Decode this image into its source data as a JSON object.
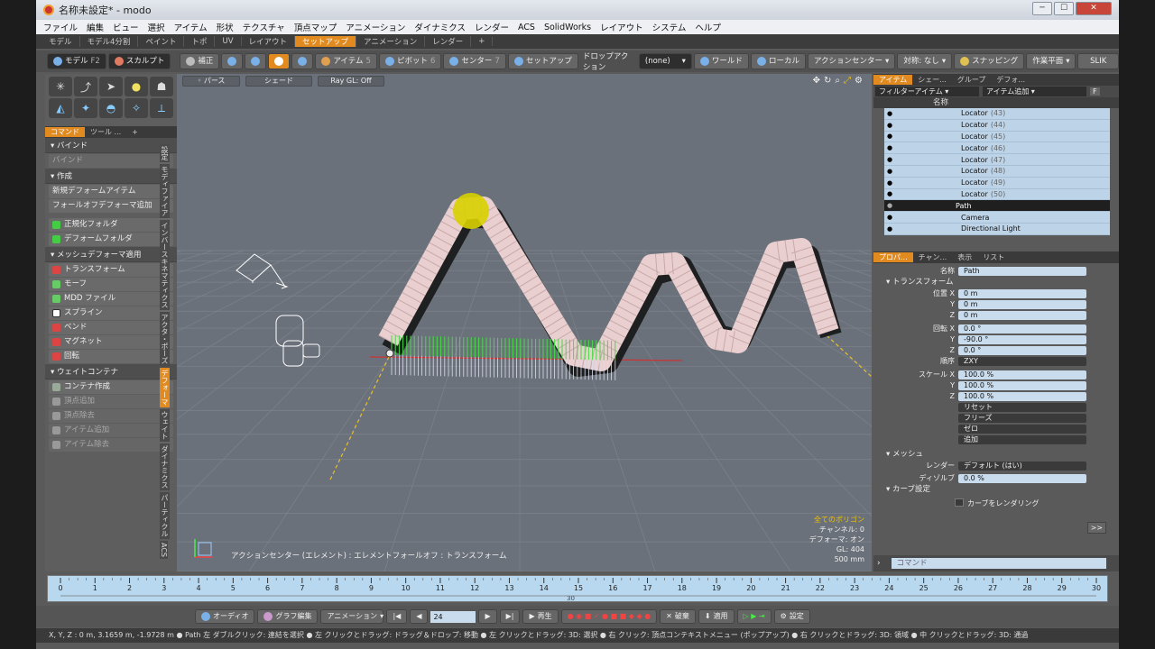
{
  "window": {
    "title": "名称未設定* - modo"
  },
  "menu": [
    "ファイル",
    "編集",
    "ビュー",
    "選択",
    "アイテム",
    "形状",
    "テクスチャ",
    "頂点マップ",
    "アニメーション",
    "ダイナミクス",
    "レンダー",
    "ACS",
    "SolidWorks",
    "レイアウト",
    "システム",
    "ヘルプ"
  ],
  "layout_tabs": [
    "モデル",
    "モデル4分割",
    "ペイント",
    "トポ",
    "UV",
    "レイアウト",
    "セットアップ",
    "アニメーション",
    "レンダー",
    "+"
  ],
  "layout_active": "セットアップ",
  "toolbar": {
    "model": "モデル",
    "model_key": "F2",
    "sculpt": "スカルプト",
    "correct": "補正",
    "item": "アイテム",
    "item_n": "5",
    "pivot": "ピボット",
    "pivot_n": "6",
    "center": "センター",
    "center_n": "7",
    "setup": "セットアップ",
    "drop_action": "ドロップアクション",
    "none": "(none)",
    "world": "ワールド",
    "local": "ローカル",
    "action_center": "アクションセンター",
    "symmetry": "対称: なし",
    "snapping": "スナッピング",
    "workplane": "作業平面",
    "slik": "SLIK"
  },
  "left": {
    "tabs": [
      "コマンド",
      "ツール ...",
      "+"
    ],
    "bind_section": "バインド",
    "bind_btn": "バインド",
    "create_section": "作成",
    "new_deformer": "新規デフォームアイテム",
    "add_falloff": "フォールオフデフォーマ追加",
    "folder_norm": "正規化フォルダ",
    "folder_deform": "デフォームフォルダ",
    "mesh_section": "メッシュデフォーマ適用",
    "items": [
      "トランスフォーム",
      "モーフ",
      "MDD ファイル",
      "スプライン",
      "ベンド",
      "マグネット",
      "回転"
    ],
    "weight_section": "ウェイトコンテナ",
    "weight_items": [
      "コンテナ作成",
      "頂点追加",
      "頂点除去",
      "アイテム追加",
      "アイテム除去"
    ],
    "vtabs": [
      "設定",
      "モディファイア",
      "インバースキネマティクス",
      "アクタ・ポーズ",
      "デフォーマ",
      "ウェイト",
      "ダイナミクス",
      "パーティクル",
      "ACS"
    ]
  },
  "viewport": {
    "btn_perspective": "パース",
    "btn_shade": "シェード",
    "btn_raygl": "Ray GL: Off",
    "status": "アクションセンター (エレメント) : エレメントフォールオフ : トランスフォーム",
    "info": [
      "全てのポリゴン",
      "チャンネル: 0",
      "デフォーマ: オン",
      "GL: 404",
      "500 mm"
    ]
  },
  "items_panel": {
    "tabs": [
      "アイテム",
      "シェー...",
      "グループ",
      "デフォ..."
    ],
    "filter": "フィルターアイテム",
    "add_item": "アイテム追加",
    "f": "F",
    "col_name": "名称",
    "rows": [
      {
        "name": "Locator",
        "count": "(43)"
      },
      {
        "name": "Locator",
        "count": "(44)"
      },
      {
        "name": "Locator",
        "count": "(45)"
      },
      {
        "name": "Locator",
        "count": "(46)"
      },
      {
        "name": "Locator",
        "count": "(47)"
      },
      {
        "name": "Locator",
        "count": "(48)"
      },
      {
        "name": "Locator",
        "count": "(49)"
      },
      {
        "name": "Locator",
        "count": "(50)"
      }
    ],
    "selected": "Path",
    "camera": "Camera",
    "light": "Directional Light"
  },
  "props": {
    "tabs": [
      "プロパ...",
      "チャン...",
      "表示",
      "リスト"
    ],
    "name_label": "名称",
    "name_value": "Path",
    "transform": "トランスフォーム",
    "pos_label": "位置 X",
    "pos": [
      "0 m",
      "0 m",
      "0 m"
    ],
    "rot_label": "回転 X",
    "rot": [
      "0.0 °",
      "-90.0 °",
      "0.0 °"
    ],
    "order_label": "順序",
    "order": "ZXY",
    "scale_label": "スケール X",
    "scale": [
      "100.0 %",
      "100.0 %",
      "100.0 %"
    ],
    "y": "Y",
    "z": "Z",
    "dd": [
      "リセット",
      "フリーズ",
      "ゼロ",
      "追加"
    ],
    "mesh": "メッシュ",
    "render_label": "レンダー",
    "render_value": "デフォルト (はい)",
    "dissolve_label": "ディゾルブ",
    "dissolve_value": "0.0 %",
    "curve": "カーブ設定",
    "curve_render": "カーブをレンダリング",
    "more": ">>",
    "vtabs": [
      "スプラインコンストレイント",
      "グループ",
      "メッシュ",
      "ユーザーチャンネル",
      "タグ"
    ]
  },
  "command": "コマンド",
  "timeline": {
    "ticks": [
      "0",
      "1",
      "2",
      "3",
      "4",
      "5",
      "6",
      "7",
      "8",
      "9",
      "10",
      "11",
      "12",
      "13",
      "14",
      "15",
      "16",
      "17",
      "18",
      "19",
      "20",
      "21",
      "22",
      "23",
      "24",
      "25",
      "26",
      "27",
      "28",
      "29",
      "30"
    ],
    "marker": "30"
  },
  "transport": {
    "audio": "オーディオ",
    "graph": "グラフ編集",
    "anim": "アニメーション",
    "frame": "24",
    "play": "再生",
    "discard": "破棄",
    "apply": "適用",
    "settings": "設定"
  },
  "status": "X, Y, Z :  0 m, 3.1659 m, -1.9728 m ● Path     左 ダブルクリック: 連結を選択 ● 左 クリックとドラッグ: ドラッグ＆ドロップ: 移動 ● 左 クリックとドラッグ: 3D: 選択 ● 右 クリック: 頂点コンテキストメニュー (ポップアップ) ● 右 クリックとドラッグ: 3D: 領域 ● 中 クリックとドラッグ: 3D: 通過"
}
